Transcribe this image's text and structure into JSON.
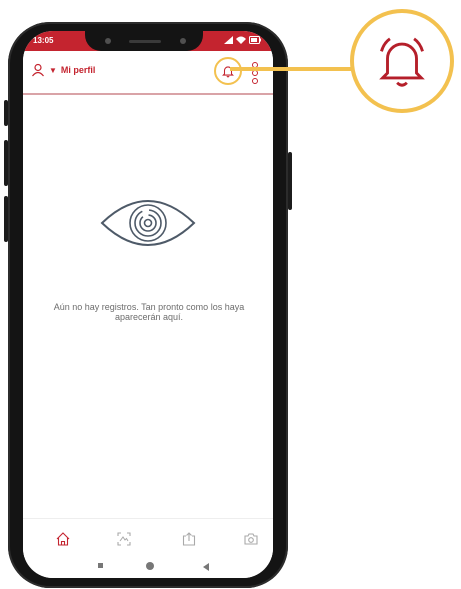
{
  "colors": {
    "brand_red": "#c4242f",
    "highlight_yellow": "#f3c14f",
    "muted_text": "#6d6d6d",
    "icon_slate": "#4e5a68"
  },
  "status_bar": {
    "time": "13:05",
    "icons": [
      "signal-icon",
      "wifi-icon",
      "battery-icon"
    ]
  },
  "header": {
    "profile_label": "Mi perfil",
    "profile_icon": "user-icon",
    "dropdown_icon": "caret-down-icon",
    "notifications_icon": "bell-icon",
    "menu_icon": "more-vertical-icon"
  },
  "empty_state": {
    "icon": "eye-maze-icon",
    "message": "Aún no hay registros. Tan pronto como los haya aparecerán aquí."
  },
  "bottom_nav": {
    "items": [
      {
        "icon": "home-icon"
      },
      {
        "icon": "scan-icon"
      },
      {
        "icon": "upload-icon"
      },
      {
        "icon": "camera-icon"
      }
    ]
  },
  "system_nav": [
    "recents-icon",
    "home-circle-icon",
    "back-icon"
  ],
  "callout": {
    "icon": "bell-icon"
  }
}
